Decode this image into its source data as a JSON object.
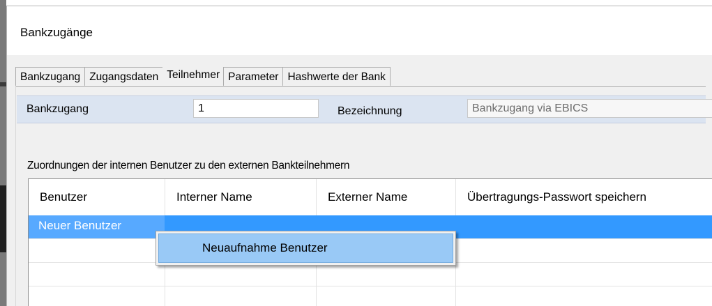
{
  "window": {
    "title": "Bankzugänge"
  },
  "tabs": [
    {
      "label": "Bankzugang"
    },
    {
      "label": "Zugangsdaten"
    },
    {
      "label": "Teilnehmer"
    },
    {
      "label": "Parameter"
    },
    {
      "label": "Hashwerte der Bank"
    }
  ],
  "active_tab": "Teilnehmer",
  "header": {
    "bankzugang_label": "Bankzugang",
    "bankzugang_value": "1",
    "bezeichnung_label": "Bezeichnung",
    "bezeichnung_value": "Bankzugang via EBICS"
  },
  "section": {
    "label": "Zuordnungen der internen Benutzer zu den externen Bankteilnehmern"
  },
  "grid": {
    "columns": [
      "Benutzer",
      "Interner Name",
      "Externer Name",
      "Übertragungs-Passwort speichern"
    ],
    "rows": [
      {
        "benutzer": "Neuer Benutzer",
        "intern": "",
        "extern": "",
        "passwort": ""
      },
      {
        "benutzer": "",
        "intern": "",
        "extern": "",
        "passwort": ""
      },
      {
        "benutzer": "",
        "intern": "",
        "extern": "",
        "passwort": ""
      },
      {
        "benutzer": "",
        "intern": "",
        "extern": "",
        "passwort": ""
      }
    ]
  },
  "context_menu": {
    "items": [
      {
        "label": "Neuaufnahme Benutzer"
      }
    ]
  },
  "colors": {
    "selection": "#3399ff",
    "menu_highlight": "#99c9f6",
    "header_bar": "#dbe4f1"
  }
}
